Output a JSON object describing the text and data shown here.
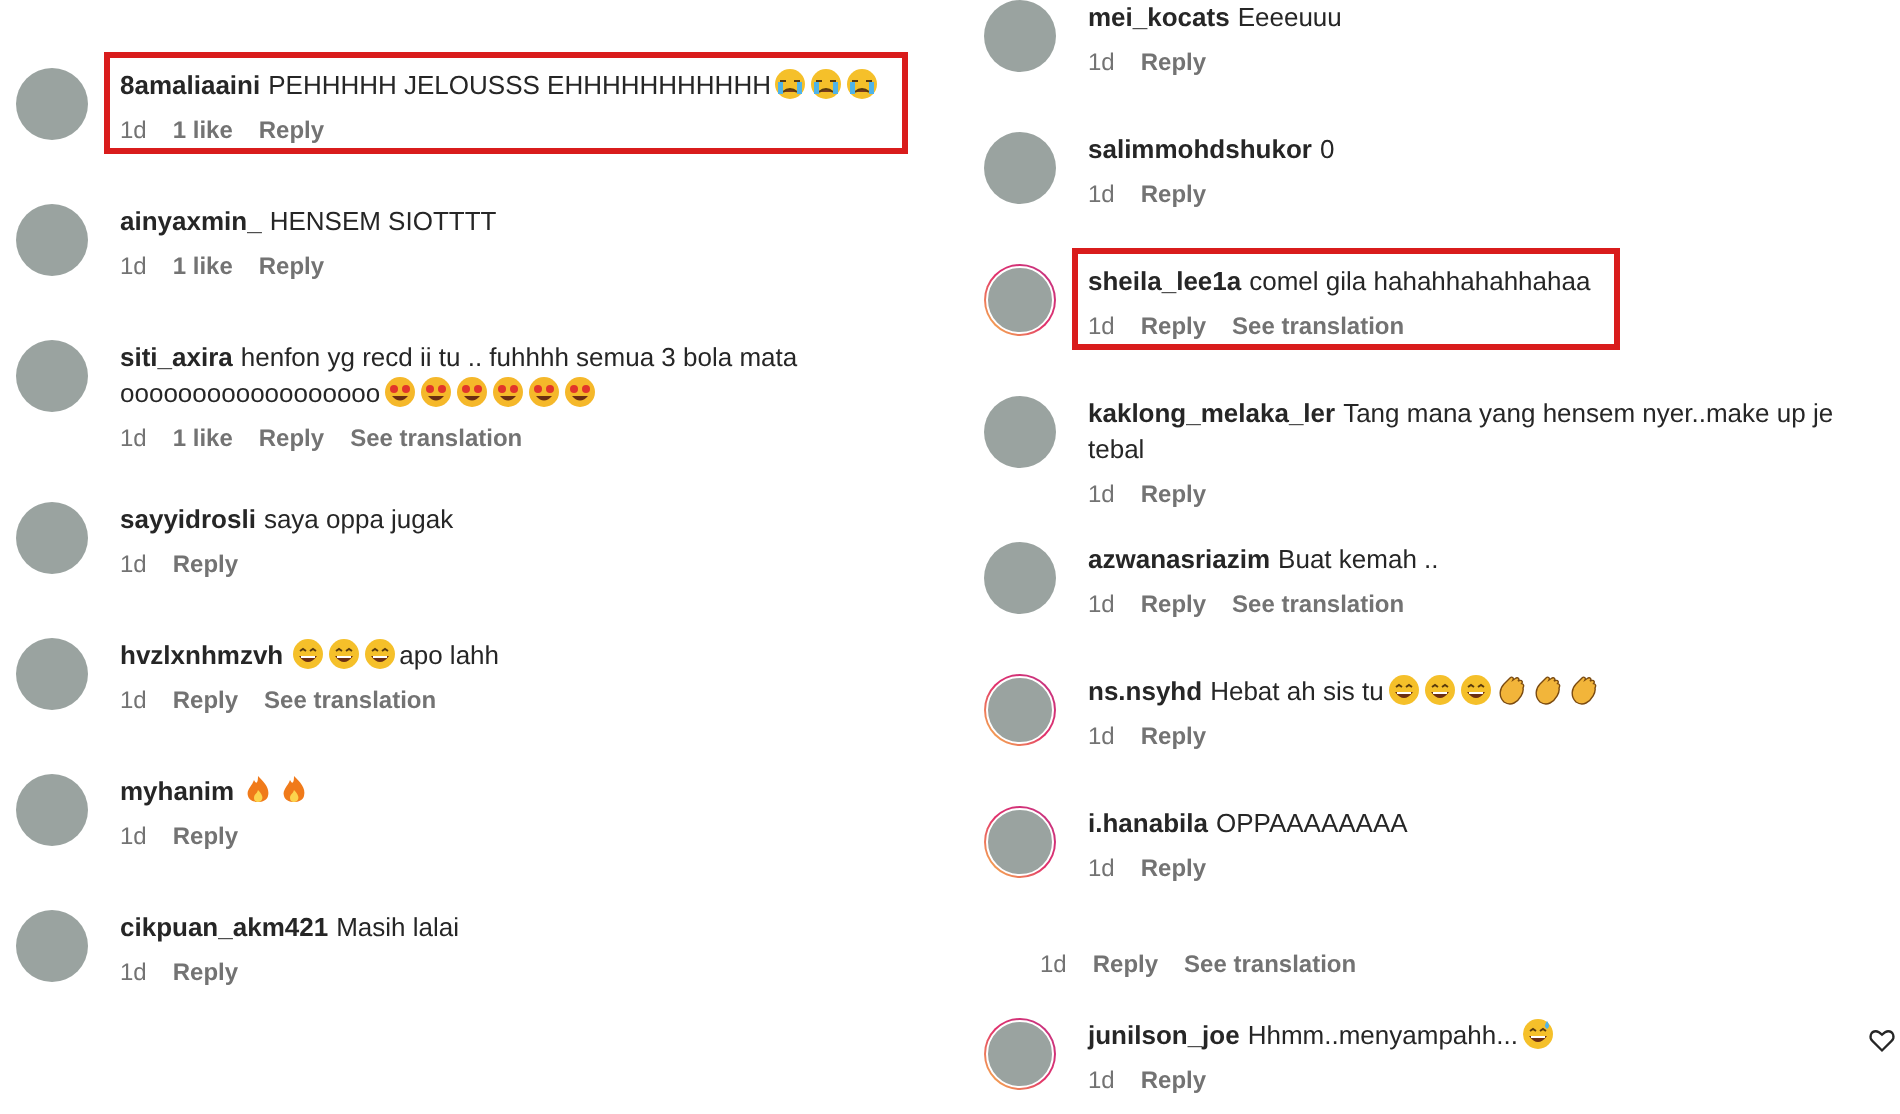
{
  "columns": [
    {
      "comments": [
        {
          "user": "8amaliaaini",
          "highlighted": true,
          "story_ring": false,
          "segments": [
            {
              "kind": "text",
              "text": "PEHHHHH JELOUSSS EHHHHHHHHHHH"
            },
            {
              "kind": "crying"
            },
            {
              "kind": "crying"
            },
            {
              "kind": "crying"
            }
          ],
          "meta": [
            {
              "kind": "time",
              "text": "1d"
            },
            {
              "kind": "likes",
              "text": "1 like"
            },
            {
              "kind": "link",
              "text": "Reply"
            }
          ]
        },
        {
          "user": "ainyaxmin_",
          "highlighted": false,
          "story_ring": false,
          "segments": [
            {
              "kind": "text",
              "text": "HENSEM SIOTTTT"
            }
          ],
          "meta": [
            {
              "kind": "time",
              "text": "1d"
            },
            {
              "kind": "likes",
              "text": "1 like"
            },
            {
              "kind": "link",
              "text": "Reply"
            }
          ]
        },
        {
          "user": "siti_axira",
          "highlighted": false,
          "story_ring": false,
          "segments": [
            {
              "kind": "text",
              "text": "henfon yg recd ii tu .. fuhhhh semua 3 bola mata"
            },
            {
              "kind": "break"
            },
            {
              "kind": "text",
              "text": "oooooooooooooooooo"
            },
            {
              "kind": "star-eyes"
            },
            {
              "kind": "star-eyes"
            },
            {
              "kind": "star-eyes"
            },
            {
              "kind": "star-eyes"
            },
            {
              "kind": "star-eyes"
            },
            {
              "kind": "star-eyes"
            }
          ],
          "meta": [
            {
              "kind": "time",
              "text": "1d"
            },
            {
              "kind": "likes",
              "text": "1 like"
            },
            {
              "kind": "link",
              "text": "Reply"
            },
            {
              "kind": "link",
              "text": "See translation"
            }
          ]
        },
        {
          "user": "sayyidrosli",
          "highlighted": false,
          "story_ring": false,
          "segments": [
            {
              "kind": "text",
              "text": "saya oppa jugak"
            }
          ],
          "meta": [
            {
              "kind": "time",
              "text": "1d"
            },
            {
              "kind": "link",
              "text": "Reply"
            }
          ]
        },
        {
          "user": "hvzlxnhmzvh",
          "highlighted": false,
          "story_ring": false,
          "segments": [
            {
              "kind": "grin"
            },
            {
              "kind": "grin"
            },
            {
              "kind": "grin"
            },
            {
              "kind": "text",
              "text": "apo lahh"
            }
          ],
          "meta": [
            {
              "kind": "time",
              "text": "1d"
            },
            {
              "kind": "link",
              "text": "Reply"
            },
            {
              "kind": "link",
              "text": "See translation"
            }
          ]
        },
        {
          "user": "myhanim",
          "highlighted": false,
          "story_ring": false,
          "segments": [
            {
              "kind": "fire"
            },
            {
              "kind": "fire"
            }
          ],
          "meta": [
            {
              "kind": "time",
              "text": "1d"
            },
            {
              "kind": "link",
              "text": "Reply"
            }
          ]
        },
        {
          "user": "cikpuan_akm421",
          "highlighted": false,
          "story_ring": false,
          "segments": [
            {
              "kind": "text",
              "text": "Masih lalai"
            }
          ],
          "meta": [
            {
              "kind": "time",
              "text": "1d"
            },
            {
              "kind": "link",
              "text": "Reply"
            }
          ]
        }
      ]
    },
    {
      "comments": [
        {
          "user": "mei_kocats",
          "highlighted": false,
          "story_ring": false,
          "segments": [
            {
              "kind": "text",
              "text": "Eeeeuuu"
            }
          ],
          "meta": [
            {
              "kind": "time",
              "text": "1d"
            },
            {
              "kind": "link",
              "text": "Reply"
            }
          ]
        },
        {
          "user": "salimmohdshukor",
          "highlighted": false,
          "story_ring": false,
          "segments": [
            {
              "kind": "text",
              "text": "0"
            }
          ],
          "meta": [
            {
              "kind": "time",
              "text": "1d"
            },
            {
              "kind": "link",
              "text": "Reply"
            }
          ]
        },
        {
          "user": "sheila_lee1a",
          "highlighted": true,
          "story_ring": true,
          "segments": [
            {
              "kind": "text",
              "text": "comel gila hahahhahahhahaa"
            }
          ],
          "meta": [
            {
              "kind": "time",
              "text": "1d"
            },
            {
              "kind": "link",
              "text": "Reply"
            },
            {
              "kind": "link",
              "text": "See translation"
            }
          ]
        },
        {
          "user": "kaklong_melaka_ler",
          "highlighted": false,
          "story_ring": false,
          "segments": [
            {
              "kind": "text",
              "text": "Tang mana yang hensem nyer..make up je"
            },
            {
              "kind": "break"
            },
            {
              "kind": "text",
              "text": "tebal"
            }
          ],
          "meta": [
            {
              "kind": "time",
              "text": "1d"
            },
            {
              "kind": "link",
              "text": "Reply"
            }
          ]
        },
        {
          "user": "azwanasriazim",
          "highlighted": false,
          "story_ring": false,
          "segments": [
            {
              "kind": "text",
              "text": "Buat kemah .."
            }
          ],
          "meta": [
            {
              "kind": "time",
              "text": "1d"
            },
            {
              "kind": "link",
              "text": "Reply"
            },
            {
              "kind": "link",
              "text": "See translation"
            }
          ]
        },
        {
          "user": "ns.nsyhd",
          "highlighted": false,
          "story_ring": true,
          "segments": [
            {
              "kind": "text",
              "text": "Hebat ah sis tu"
            },
            {
              "kind": "grin"
            },
            {
              "kind": "grin"
            },
            {
              "kind": "grin"
            },
            {
              "kind": "clap"
            },
            {
              "kind": "clap"
            },
            {
              "kind": "clap"
            }
          ],
          "meta": [
            {
              "kind": "time",
              "text": "1d"
            },
            {
              "kind": "link",
              "text": "Reply"
            }
          ]
        },
        {
          "user": "i.hanabila",
          "highlighted": false,
          "story_ring": true,
          "segments": [
            {
              "kind": "text",
              "text": "OPPAAAAAAAA"
            }
          ],
          "meta": [
            {
              "kind": "time",
              "text": "1d"
            },
            {
              "kind": "link",
              "text": "Reply"
            }
          ]
        },
        {
          "meta": [
            {
              "kind": "time",
              "text": "1d"
            },
            {
              "kind": "link",
              "text": "Reply"
            },
            {
              "kind": "link",
              "text": "See translation"
            }
          ]
        },
        {
          "user": "junilson_joe",
          "highlighted": false,
          "story_ring": true,
          "like_button": true,
          "segments": [
            {
              "kind": "text",
              "text": "Hhmm..menyampahh..."
            },
            {
              "kind": "sweat-grin"
            }
          ],
          "meta": [
            {
              "kind": "time",
              "text": "1d"
            },
            {
              "kind": "link",
              "text": "Reply"
            }
          ]
        }
      ]
    }
  ]
}
